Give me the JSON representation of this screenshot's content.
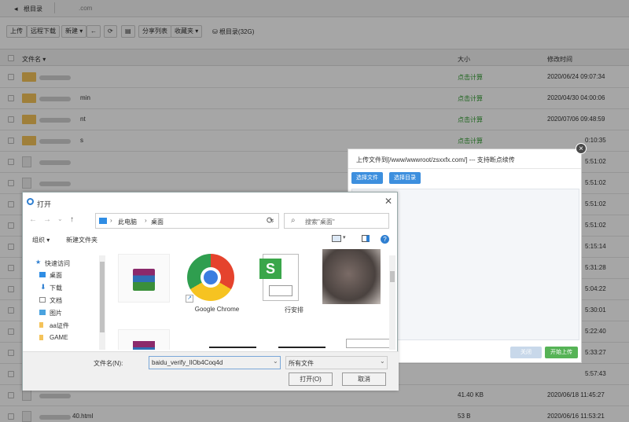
{
  "breadcrumb": {
    "home": "根目录",
    "domain": ".com"
  },
  "toolbar": {
    "upload": "上传",
    "remote_download": "远程下载",
    "new": "新建",
    "back": "←",
    "refresh": "⟳",
    "terminal": "▤",
    "share_list": "分享列表",
    "favorites": "收藏夹",
    "disk": "根目录(32G)"
  },
  "table": {
    "headers": {
      "name": "文件名",
      "size": "大小",
      "time": "修改时间"
    },
    "rows": [
      {
        "name": "",
        "size": "点击计算",
        "time": "2020/06/24 09:07:34",
        "type": "folder"
      },
      {
        "name": "min",
        "size": "点击计算",
        "time": "2020/04/30 04:00:06",
        "type": "folder"
      },
      {
        "name": "nt",
        "size": "点击计算",
        "time": "2020/07/06 09:48:59",
        "type": "folder"
      },
      {
        "name": "s",
        "size": "点击计算",
        "time": "0:10:35",
        "type": "folder"
      },
      {
        "name": "",
        "size": "",
        "time": "5:51:02",
        "type": "doc"
      },
      {
        "name": "",
        "size": "",
        "time": "5:51:02",
        "type": "doc"
      },
      {
        "name": "",
        "size": "",
        "time": "5:51:02",
        "type": "doc"
      },
      {
        "name": "",
        "size": "",
        "time": "5:51:02",
        "type": "doc"
      },
      {
        "name": "",
        "size": "",
        "time": "5:15:14",
        "type": "doc"
      },
      {
        "name": "",
        "size": "",
        "time": "5:31:28",
        "type": "doc"
      },
      {
        "name": "",
        "size": "",
        "time": "5:04:22",
        "type": "doc"
      },
      {
        "name": "",
        "size": "",
        "time": "5:30:01",
        "type": "doc"
      },
      {
        "name": "",
        "size": "",
        "time": "5:22:40",
        "type": "doc"
      },
      {
        "name": "",
        "size": "",
        "time": "5:33:27",
        "type": "doc"
      },
      {
        "name": "",
        "size": "",
        "time": "5:57:43",
        "type": "doc"
      },
      {
        "name": "",
        "size": "41.40 KB",
        "time": "2020/06/18 11:45:27",
        "type": "doc"
      },
      {
        "name": "40.html",
        "size": "53 B",
        "time": "2020/06/16 11:53:21",
        "type": "html"
      }
    ]
  },
  "uploader": {
    "title": "上传文件到[/www/wwwroot/zsxxfx.com/] --- 支持断点续传",
    "select_file": "选择文件",
    "select_dir": "选择目录",
    "close": "关闭",
    "start_upload": "开始上传",
    "close_x": "×"
  },
  "open_dialog": {
    "title": "打开",
    "close_x": "✕",
    "path": [
      "此电脑",
      "桌面"
    ],
    "search_placeholder": "搜索\"桌面\"",
    "organize": "组织 ▾",
    "new_folder": "新建文件夹",
    "help": "?",
    "tree": [
      {
        "label": "快速访问",
        "icon": "star-icon"
      },
      {
        "label": "桌面",
        "icon": "desktop-icon"
      },
      {
        "label": "下载",
        "icon": "download-icon"
      },
      {
        "label": "文档",
        "icon": "document-icon"
      },
      {
        "label": "图片",
        "icon": "picture-icon"
      },
      {
        "label": "aa证件",
        "icon": "folder-icon"
      },
      {
        "label": "GAME",
        "icon": "folder-icon"
      }
    ],
    "tiles": [
      {
        "label": "",
        "icon": "winrar-icon"
      },
      {
        "label": "Google Chrome",
        "icon": "chrome-icon"
      },
      {
        "label": "行安排",
        "icon": "spreadsheet-icon"
      },
      {
        "label": "",
        "icon": "photo-icon"
      }
    ],
    "filename_label": "文件名(N):",
    "filename_value": "baidu_verify_lIOb4Coq4d",
    "filetype": "所有文件",
    "open": "打开(O)",
    "cancel": "取消"
  },
  "colors": {
    "accent_blue": "#3d8fde",
    "green": "#2e9b2e",
    "folder": "#f4c35a"
  }
}
